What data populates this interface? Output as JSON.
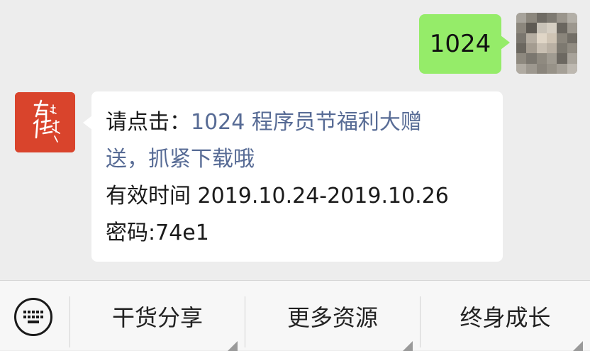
{
  "chat": {
    "outgoing": {
      "text": "1024"
    },
    "incoming": {
      "prefix": "请点击：",
      "link_line1": "1024 程序员节福利大赠",
      "link_line2": "送，抓紧下载哦",
      "validity": "有效时间 2019.10.24-2019.10.26",
      "password": "密码:74e1",
      "avatar_text": "有课修行"
    }
  },
  "menu": {
    "keyboard_icon": "keyboard-icon",
    "items": [
      {
        "label": "干货分享"
      },
      {
        "label": "更多资源"
      },
      {
        "label": "终身成长"
      }
    ]
  },
  "colors": {
    "chat_bg": "#ededed",
    "outgoing_bubble": "#95ec69",
    "incoming_bubble": "#ffffff",
    "link": "#576b95",
    "avatar_red": "#d9442c",
    "menubar_bg": "#f7f7f7"
  }
}
